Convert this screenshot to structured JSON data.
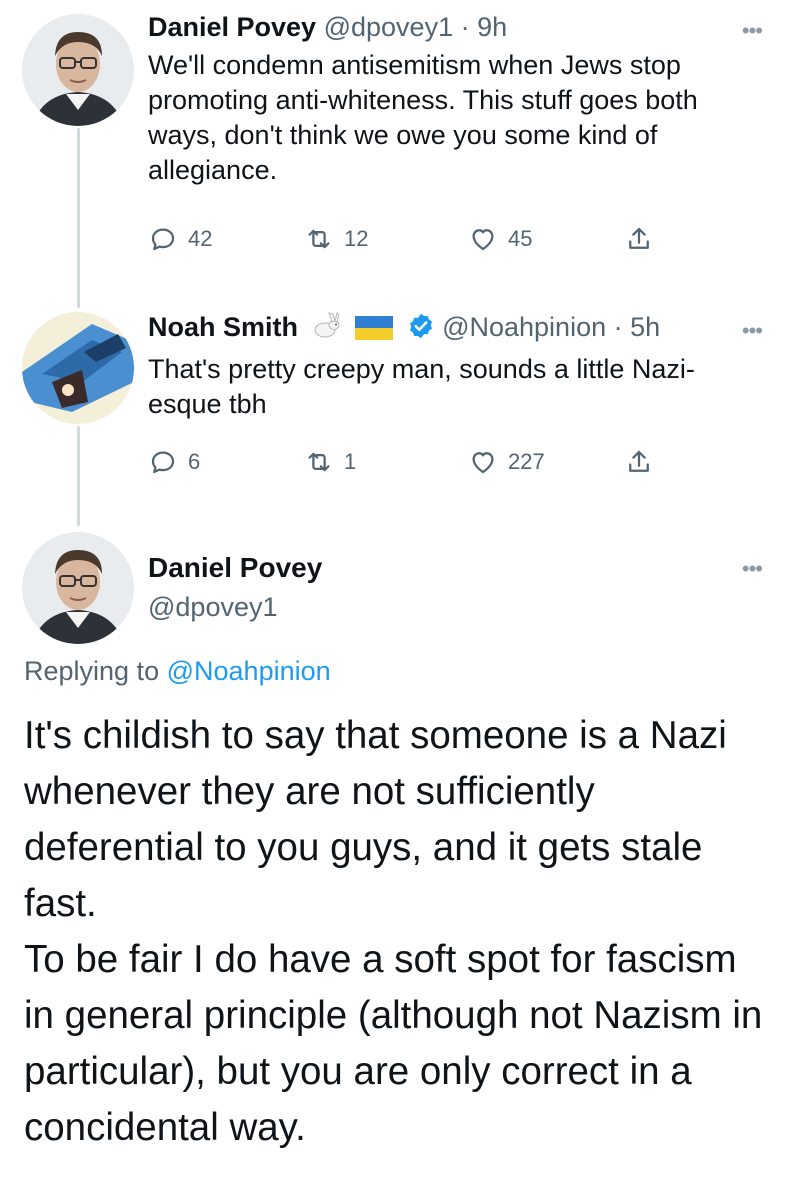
{
  "tweets": [
    {
      "name": "Daniel Povey",
      "handle": "@dpovey1",
      "time": "9h",
      "text": "We'll condemn antisemitism when Jews stop promoting anti-whiteness.  This stuff goes both ways, don't think we owe you some kind of allegiance.",
      "replies": "42",
      "retweets": "12",
      "likes": "45"
    },
    {
      "name": "Noah Smith",
      "handle": "@Noahpinion",
      "time": "5h",
      "text": "That's pretty creepy man, sounds a little Nazi-esque tbh",
      "replies": "6",
      "retweets": "1",
      "likes": "227",
      "badges": [
        "rabbit-emoji",
        "ukraine-flag",
        "verified-badge"
      ]
    }
  ],
  "main_tweet": {
    "name": "Daniel Povey",
    "handle": "@dpovey1",
    "replying_prefix": "Replying to",
    "replying_to": "@Noahpinion",
    "paragraphs": [
      "It's childish to say that someone is a Nazi whenever they are not sufficiently deferential to you guys, and it gets stale fast.",
      "To be fair I do have a soft spot for fascism in general principle (although not Nazism in particular), but you are only correct in a concidental way."
    ]
  },
  "separator": "·",
  "more_glyph": "•••",
  "colors": {
    "text": "#0f1419",
    "secondary": "#536471",
    "link": "#1d9bf0",
    "thread_line": "#cfd9de",
    "verified": "#1d9bf0"
  },
  "icons": [
    "reply-icon",
    "retweet-icon",
    "like-icon",
    "share-icon",
    "more-icon"
  ]
}
